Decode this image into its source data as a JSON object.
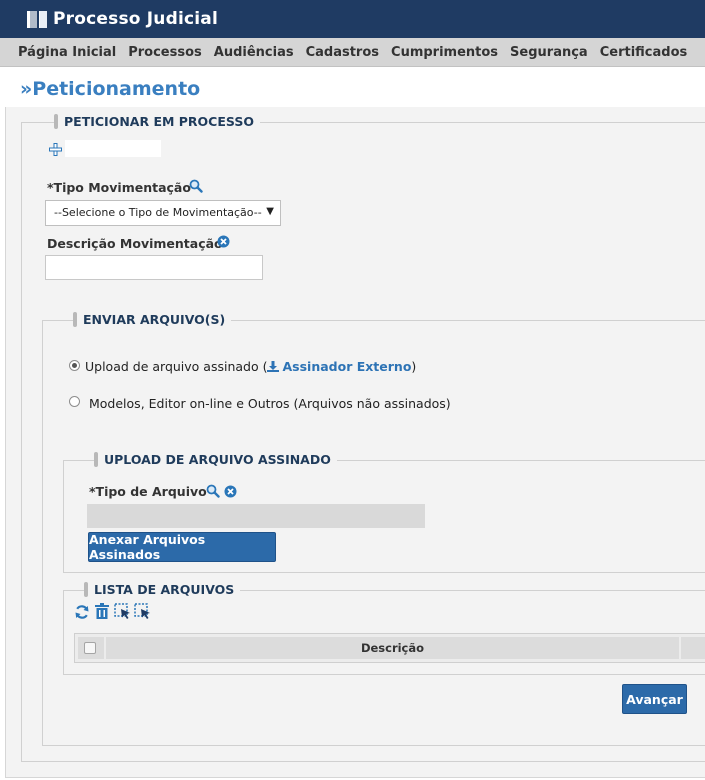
{
  "header": {
    "title": "Processo Judicial",
    "icon": "book-icon",
    "color": "#1f3b63"
  },
  "menu": {
    "items": [
      "Página Inicial",
      "Processos",
      "Audiências",
      "Cadastros",
      "Cumprimentos",
      "Segurança",
      "Certificados"
    ]
  },
  "page": {
    "title": "»Peticionamento"
  },
  "peticionar": {
    "legend": "PETICIONAR EM PROCESSO",
    "tipo_label": "*Tipo Movimentação",
    "tipo_select": "--Selecione o Tipo de Movimentação--",
    "descricao_label": "Descrição Movimentação",
    "descricao_value": ""
  },
  "enviar": {
    "legend": "ENVIAR ARQUIVO(S)",
    "option1_prefix": "Upload de arquivo assinado (",
    "option1_link": "Assinador Externo",
    "option1_suffix": ")",
    "option2": "Modelos, Editor on-line e Outros (Arquivos não assinados)"
  },
  "upload": {
    "legend": "UPLOAD DE ARQUIVO ASSINADO",
    "tipo_label": "*Tipo de Arquivo",
    "tipo_value": "",
    "anexar_button": "Anexar Arquivos Assinados"
  },
  "lista": {
    "legend": "LISTA DE ARQUIVOS",
    "column_descricao": "Descrição"
  },
  "actions": {
    "avancar": "Avançar"
  },
  "colors": {
    "accent": "#3a7fc0",
    "button": "#2c6aa9",
    "icon_blue": "#2a76b8"
  }
}
